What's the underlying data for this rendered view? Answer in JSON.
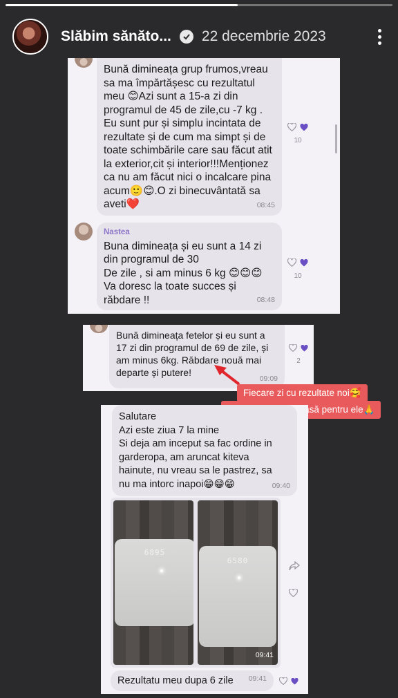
{
  "story": {
    "account_name": "Slăbim sănăto...",
    "date": "22 decembrie 2023",
    "progress_fraction": 0.6
  },
  "messages": [
    {
      "sender_cut": "...",
      "text": "Bună dimineața grup frumos,vreau\nsa ma împărtășesc cu rezultatul\nmeu 😊Azi sunt a 15-a zi din\nprogramul de 45 de zile,cu -7 kg .\nEu sunt pur și simplu incintata de\nrezultate și de cum ma simpt și de\ntoate schimbările care sau făcut atit\nla exterior,cit și interior!!!Menționez\nca nu am făcut nici o incalcare pina\nacum🙂😊.O zi binecuvântată sa\naveti❤️",
      "time": "08:45",
      "reaction_count": "10"
    },
    {
      "sender": "Nastea",
      "text": "Buna dimineața  și eu sunt a 14 zi\ndin programul de 30\nDe zile , si am minus 6 kg 😊😊😊\nVa doresc la toate succes și\nrăbdare !!",
      "time": "08:48",
      "reaction_count": "10"
    },
    {
      "text": "Bună dimineața fetelor și eu sunt a\n17 zi din programul de 69 de zile, și\nam minus 6kg. Răbdare nouă mai\ndeparte și putere!",
      "time": "09:09",
      "reaction_count": "2"
    },
    {
      "text": "Salutare\nAzi este ziua 7 la mine\nSi deja am inceput sa fac ordine  in\ngarderopa, am aruncat kiteva\nhainute,  nu vreau sa le pastrez,  sa\nnu ma intorc inapoi😁😁😁",
      "time": "09:40"
    },
    {
      "photo_time": "09:41",
      "scale_readings": [
        "6895",
        "6580"
      ]
    },
    {
      "text": "Rezultatu meu dupa 6 zile",
      "time": "09:41"
    }
  ],
  "overlay": {
    "line1": "Fiecare zi cu rezultate noi🥰",
    "line2": "Sunt foarte bucuroasă pentru ele🙏"
  },
  "colors": {
    "overlay_bg": "#e85a5c",
    "reaction_heart": "#6a4fc4",
    "sender_name": "#8d75c9"
  },
  "icons": [
    "verified-icon",
    "more-icon",
    "heart-outline-icon",
    "heart-filled-icon",
    "share-icon",
    "arrow-icon"
  ]
}
